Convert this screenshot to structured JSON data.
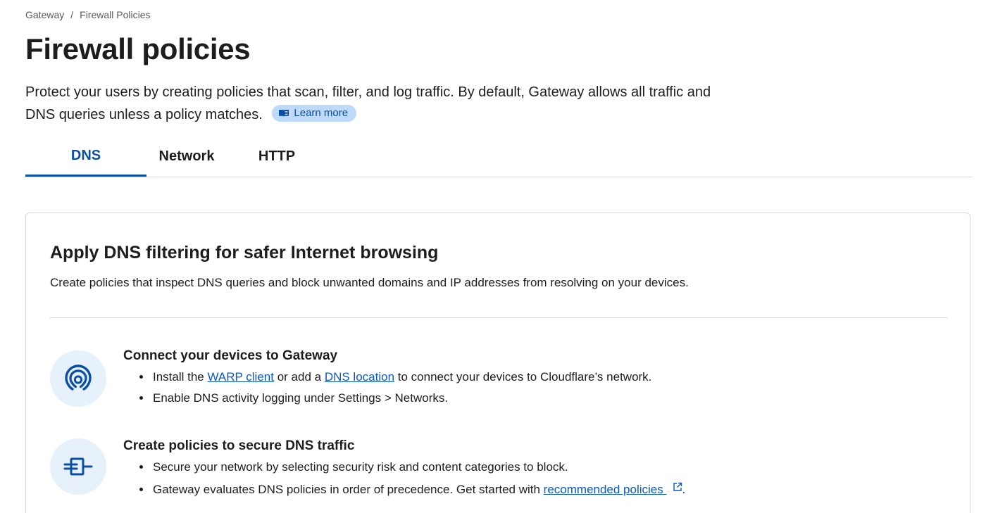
{
  "breadcrumb": {
    "root": "Gateway",
    "separator": "/",
    "current": "Firewall Policies"
  },
  "page": {
    "title": "Firewall policies",
    "description": "Protect your users by creating policies that scan, filter, and log traffic. By default, Gateway allows all traffic and DNS queries unless a policy matches.",
    "learn_more": "Learn more",
    "learn_more_icon": "book-icon"
  },
  "tabs": [
    {
      "label": "DNS",
      "active": true
    },
    {
      "label": "Network",
      "active": false
    },
    {
      "label": "HTTP",
      "active": false
    }
  ],
  "card": {
    "title": "Apply DNS filtering for safer Internet browsing",
    "subtitle": "Create policies that inspect DNS queries and block unwanted domains and IP addresses from resolving on your devices.",
    "steps": [
      {
        "icon": "wifi-signal-icon",
        "title": "Connect your devices to Gateway",
        "bullets": [
          {
            "t1": "Install the ",
            "link1": "WARP client",
            "t2": " or add a ",
            "link2": "DNS location",
            "t3": " to connect your devices to Cloudflare’s network."
          },
          {
            "text": "Enable DNS activity logging under Settings > Networks."
          }
        ]
      },
      {
        "icon": "firewall-icon",
        "title": "Create policies to secure DNS traffic",
        "bullets": [
          {
            "text": "Secure your network by selecting security risk and content categories to block."
          },
          {
            "t1": "Gateway evaluates DNS policies in order of precedence. Get started with ",
            "link": "recommended policies",
            "t2": ".",
            "link_icon": "external-link-icon"
          }
        ]
      }
    ]
  },
  "colors": {
    "accent": "#0a4ea5",
    "link": "#0a58ca",
    "pill_bg": "#bfd9f8",
    "icon_circle_bg": "#e6f1fb",
    "border": "#d9d9d9",
    "text": "#1d1d1d"
  }
}
